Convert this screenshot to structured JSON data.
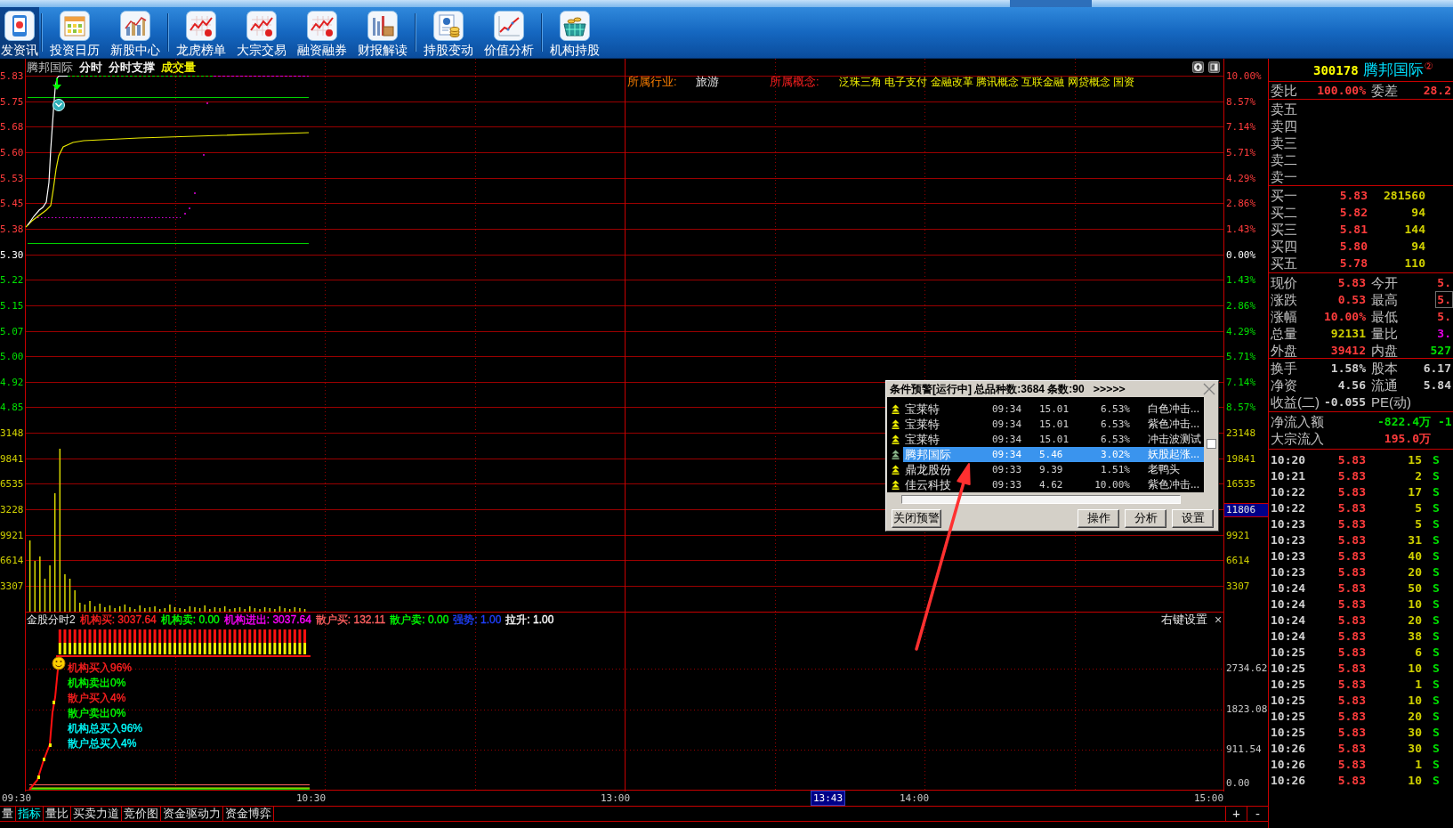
{
  "toolbar": {
    "groups": [
      {
        "items": [
          {
            "label": "发资讯",
            "kind": "app",
            "selected": true
          }
        ]
      },
      {
        "items": [
          {
            "label": "投资日历",
            "kind": "calendar",
            "selected": false
          },
          {
            "label": "新股中心",
            "kind": "ipo",
            "selected": false
          }
        ]
      },
      {
        "items": [
          {
            "label": "龙虎榜单",
            "kind": "trend",
            "selected": false
          },
          {
            "label": "大宗交易",
            "kind": "trend",
            "selected": false
          },
          {
            "label": "融资融券",
            "kind": "trend",
            "selected": false
          },
          {
            "label": "财报解读",
            "kind": "report",
            "selected": false
          }
        ]
      },
      {
        "items": [
          {
            "label": "持股变动",
            "kind": "holding",
            "selected": false
          },
          {
            "label": "价值分析",
            "kind": "value",
            "selected": false
          }
        ]
      },
      {
        "items": [
          {
            "label": "机构持股",
            "kind": "basket",
            "selected": false
          }
        ]
      }
    ]
  },
  "chart": {
    "title": "腾邦国际",
    "modes": [
      {
        "label": "分时",
        "color": "#ffffff"
      },
      {
        "label": "分时支撑",
        "color": "#ffffff"
      },
      {
        "label": "成交量",
        "color": "#ffff00"
      }
    ],
    "industry_label": "所属行业:",
    "industry": "旅游",
    "concept_label": "所属概念:",
    "concepts": "泛珠三角 电子支付 金融改革 腾讯概念 互联金融 网贷概念 国资",
    "price_axis": [
      {
        "text": "5.83",
        "color": "#ff3c3c"
      },
      {
        "text": "5.75",
        "color": "#ff3c3c"
      },
      {
        "text": "5.68",
        "color": "#ff3c3c"
      },
      {
        "text": "5.60",
        "color": "#ff3c3c"
      },
      {
        "text": "5.53",
        "color": "#ff3c3c"
      },
      {
        "text": "5.45",
        "color": "#ff3c3c"
      },
      {
        "text": "5.38",
        "color": "#ff3c3c"
      },
      {
        "text": "5.30",
        "color": "#ffffff"
      },
      {
        "text": "5.22",
        "color": "#00e000"
      },
      {
        "text": "5.15",
        "color": "#00e000"
      },
      {
        "text": "5.07",
        "color": "#00e000"
      },
      {
        "text": "5.00",
        "color": "#00e000"
      },
      {
        "text": "4.92",
        "color": "#00e000"
      },
      {
        "text": "4.85",
        "color": "#00e000"
      }
    ],
    "volume_axis": [
      "3148",
      "9841",
      "6535",
      "3228",
      "9921",
      "6614",
      "3307"
    ],
    "percent_axis": [
      {
        "text": "10.00%",
        "color": "#ff3c3c"
      },
      {
        "text": "8.57%",
        "color": "#ff3c3c"
      },
      {
        "text": "7.14%",
        "color": "#ff3c3c"
      },
      {
        "text": "5.71%",
        "color": "#ff3c3c"
      },
      {
        "text": "4.29%",
        "color": "#ff3c3c"
      },
      {
        "text": "2.86%",
        "color": "#ff3c3c"
      },
      {
        "text": "1.43%",
        "color": "#ff3c3c"
      },
      {
        "text": "0.00%",
        "color": "#ffffff"
      },
      {
        "text": "1.43%",
        "color": "#00e000"
      },
      {
        "text": "2.86%",
        "color": "#00e000"
      },
      {
        "text": "4.29%",
        "color": "#00e000"
      },
      {
        "text": "5.71%",
        "color": "#00e000"
      },
      {
        "text": "7.14%",
        "color": "#00e000"
      },
      {
        "text": "8.57%",
        "color": "#00e000"
      }
    ],
    "right_volume_axis": [
      {
        "text": "23148",
        "highlighted": false
      },
      {
        "text": "19841",
        "highlighted": false
      },
      {
        "text": "16535",
        "highlighted": false
      },
      {
        "text": "11806",
        "highlighted": true
      },
      {
        "text": "9921",
        "highlighted": false
      },
      {
        "text": "6614",
        "highlighted": false
      },
      {
        "text": "3307",
        "highlighted": false
      }
    ]
  },
  "indicator": {
    "name": "金股分时2",
    "readings": [
      {
        "text": "机构买: 3037.64",
        "color": "#ff2020"
      },
      {
        "text": "机构卖: 0.00",
        "color": "#00ff00"
      },
      {
        "text": "机构进出: 3037.64",
        "color": "#ff00ff"
      },
      {
        "text": "散户买: 132.11",
        "color": "#ff6060"
      },
      {
        "text": "散户卖: 0.00",
        "color": "#00ff00"
      },
      {
        "text": "强势: 1.00",
        "color": "#2040ff"
      },
      {
        "text": "拉升: 1.00",
        "color": "#ffffff"
      }
    ],
    "settings": "右键设置",
    "close": "×",
    "legend": [
      {
        "text": "机构买入96%",
        "color": "#ff2020"
      },
      {
        "text": "机构卖出0%",
        "color": "#00ff00"
      },
      {
        "text": "散户买入4%",
        "color": "#ff2020"
      },
      {
        "text": "散户卖出0%",
        "color": "#00ff00"
      },
      {
        "text": "机构总买入96%",
        "color": "#00ffff"
      },
      {
        "text": "散户总买入4%",
        "color": "#00ffff"
      }
    ],
    "axis": [
      "2734.62",
      "1823.08",
      "911.54",
      "0.00"
    ]
  },
  "time_axis": [
    {
      "text": "09:30",
      "highlighted": false
    },
    {
      "text": "10:30",
      "highlighted": false
    },
    {
      "text": "13:00",
      "highlighted": false
    },
    {
      "text": "13:43",
      "highlighted": true
    },
    {
      "text": "14:00",
      "highlighted": false
    },
    {
      "text": "15:00",
      "highlighted": false
    }
  ],
  "bottom_tabs": [
    {
      "label": "量",
      "selected": false
    },
    {
      "label": "指标",
      "selected": true
    },
    {
      "label": "量比",
      "selected": false
    },
    {
      "label": "买卖力道",
      "selected": false
    },
    {
      "label": "竞价图",
      "selected": false
    },
    {
      "label": "资金驱动力",
      "selected": false
    },
    {
      "label": "资金博弈",
      "selected": false
    }
  ],
  "zoom_buttons": [
    "+",
    "-"
  ],
  "alert_dialog": {
    "title": "条件预警[运行中] 总品种数:3684 条数:90",
    "more": ">>>>>",
    "rows": [
      {
        "name": "宝莱特",
        "time": "09:34",
        "price": "15.01",
        "change": "6.53%",
        "signal": "白色冲击...",
        "selected": false
      },
      {
        "name": "宝莱特",
        "time": "09:34",
        "price": "15.01",
        "change": "6.53%",
        "signal": "紫色冲击...",
        "selected": false
      },
      {
        "name": "宝莱特",
        "time": "09:34",
        "price": "15.01",
        "change": "6.53%",
        "signal": "冲击波测试",
        "selected": false
      },
      {
        "name": "腾邦国际",
        "time": "09:34",
        "price": "5.46",
        "change": "3.02%",
        "signal": "妖股起涨...",
        "selected": true
      },
      {
        "name": "鼎龙股份",
        "time": "09:33",
        "price": "9.39",
        "change": "1.51%",
        "signal": "老鸭头",
        "selected": false
      },
      {
        "name": "佳云科技",
        "time": "09:33",
        "price": "4.62",
        "change": "10.00%",
        "signal": "紫色冲击...",
        "selected": false
      }
    ],
    "side_checkbox": {
      "checked": false
    },
    "buttons": [
      {
        "label": "关闭预警",
        "kind": "left"
      },
      {
        "label": "操作",
        "kind": "right"
      },
      {
        "label": "分析",
        "kind": "right"
      },
      {
        "label": "设置",
        "kind": "right"
      }
    ]
  },
  "quote_panel": {
    "code": "300178",
    "name": "腾邦国际",
    "badge": "②",
    "ratio": [
      {
        "label": "委比",
        "value": "100.00%"
      },
      {
        "label": "委差",
        "value": "28.2"
      }
    ],
    "asks": [
      "卖五",
      "卖四",
      "卖三",
      "卖二",
      "卖一"
    ],
    "bids": [
      {
        "label": "买一",
        "price": "5.83",
        "volume": "281560"
      },
      {
        "label": "买二",
        "price": "5.82",
        "volume": "94"
      },
      {
        "label": "买三",
        "price": "5.81",
        "volume": "144"
      },
      {
        "label": "买四",
        "price": "5.80",
        "volume": "94"
      },
      {
        "label": "买五",
        "price": "5.78",
        "volume": "110"
      }
    ],
    "stats": [
      {
        "label": "现价",
        "value": "5.83",
        "color": "#ff3c3c",
        "framed": false
      },
      {
        "label": "今开",
        "value": "5.",
        "color": "#ff3c3c",
        "framed": false
      },
      {
        "label": "涨跌",
        "value": "0.53",
        "color": "#ff3c3c",
        "framed": false
      },
      {
        "label": "最高",
        "value": "5.",
        "color": "#ff3c3c",
        "framed": true
      },
      {
        "label": "涨幅",
        "value": "10.00%",
        "color": "#ff3c3c",
        "framed": false
      },
      {
        "label": "最低",
        "value": "5.",
        "color": "#ff3c3c",
        "framed": false
      },
      {
        "label": "总量",
        "value": "92131",
        "color": "#d0d000",
        "framed": false
      },
      {
        "label": "量比",
        "value": "3.",
        "color": "#e000e0",
        "framed": false
      },
      {
        "label": "外盘",
        "value": "39412",
        "color": "#ff3c3c",
        "framed": false
      },
      {
        "label": "内盘",
        "value": "527",
        "color": "#00e000",
        "framed": false
      }
    ],
    "fundamentals": [
      {
        "label": "换手",
        "value": "1.58%"
      },
      {
        "label": "股本",
        "value": "6.17"
      },
      {
        "label": "净资",
        "value": "4.56"
      },
      {
        "label": "流通",
        "value": "5.84"
      },
      {
        "label": "收益(二)",
        "value": "-0.055"
      },
      {
        "label": "PE(动)"
      }
    ],
    "flows": [
      {
        "label": "净流入额",
        "value": "-822.4万",
        "extra": "-1",
        "color": "#00e000"
      },
      {
        "label": "大宗流入",
        "value": "195.0万",
        "color": "#ff3c3c"
      }
    ],
    "ticks": [
      {
        "time": "10:20",
        "price": "5.83",
        "volume": "15",
        "side": "S"
      },
      {
        "time": "10:21",
        "price": "5.83",
        "volume": "2",
        "side": "S"
      },
      {
        "time": "10:22",
        "price": "5.83",
        "volume": "17",
        "side": "S"
      },
      {
        "time": "10:22",
        "price": "5.83",
        "volume": "5",
        "side": "S"
      },
      {
        "time": "10:23",
        "price": "5.83",
        "volume": "5",
        "side": "S"
      },
      {
        "time": "10:23",
        "price": "5.83",
        "volume": "31",
        "side": "S"
      },
      {
        "time": "10:23",
        "price": "5.83",
        "volume": "40",
        "side": "S"
      },
      {
        "time": "10:23",
        "price": "5.83",
        "volume": "20",
        "side": "S"
      },
      {
        "time": "10:24",
        "price": "5.83",
        "volume": "50",
        "side": "S"
      },
      {
        "time": "10:24",
        "price": "5.83",
        "volume": "10",
        "side": "S"
      },
      {
        "time": "10:24",
        "price": "5.83",
        "volume": "20",
        "side": "S"
      },
      {
        "time": "10:24",
        "price": "5.83",
        "volume": "38",
        "side": "S"
      },
      {
        "time": "10:25",
        "price": "5.83",
        "volume": "6",
        "side": "S"
      },
      {
        "time": "10:25",
        "price": "5.83",
        "volume": "10",
        "side": "S"
      },
      {
        "time": "10:25",
        "price": "5.83",
        "volume": "1",
        "side": "S"
      },
      {
        "time": "10:25",
        "price": "5.83",
        "volume": "10",
        "side": "S"
      },
      {
        "time": "10:25",
        "price": "5.83",
        "volume": "20",
        "side": "S"
      },
      {
        "time": "10:25",
        "price": "5.83",
        "volume": "30",
        "side": "S"
      },
      {
        "time": "10:26",
        "price": "5.83",
        "volume": "30",
        "side": "S"
      },
      {
        "time": "10:26",
        "price": "5.83",
        "volume": "1",
        "side": "S"
      },
      {
        "time": "10:26",
        "price": "5.83",
        "volume": "10",
        "side": "S"
      }
    ]
  }
}
